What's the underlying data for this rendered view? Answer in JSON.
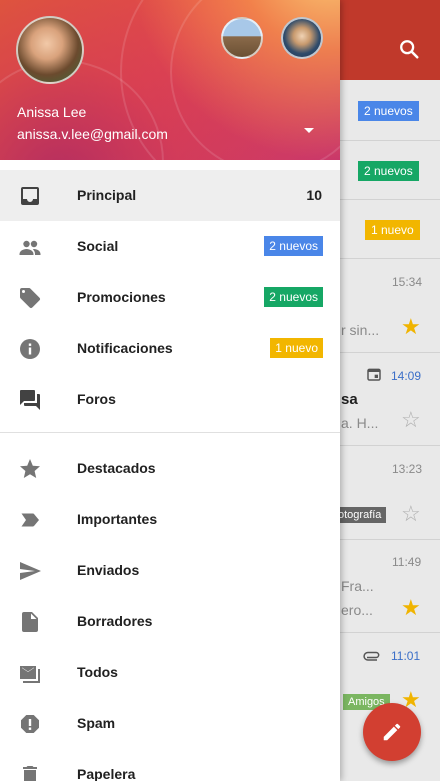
{
  "account": {
    "name": "Anissa Lee",
    "email": "anissa.v.lee@gmail.com"
  },
  "categories": [
    {
      "label": "Principal",
      "icon": "inbox-icon",
      "count": "10",
      "badge": ""
    },
    {
      "label": "Social",
      "icon": "people-icon",
      "count": "",
      "badge": "2 nuevos",
      "badge_color": "#4a86e8"
    },
    {
      "label": "Promociones",
      "icon": "tag-icon",
      "count": "",
      "badge": "2 nuevos",
      "badge_color": "#16a765"
    },
    {
      "label": "Notificaciones",
      "icon": "info-icon",
      "count": "",
      "badge": "1 nuevo",
      "badge_color": "#f2b600"
    },
    {
      "label": "Foros",
      "icon": "forum-icon",
      "count": "",
      "badge": ""
    }
  ],
  "folders": [
    {
      "label": "Destacados",
      "icon": "star-icon"
    },
    {
      "label": "Importantes",
      "icon": "important-icon"
    },
    {
      "label": "Enviados",
      "icon": "send-icon"
    },
    {
      "label": "Borradores",
      "icon": "draft-icon"
    },
    {
      "label": "Todos",
      "icon": "all-mail-icon"
    },
    {
      "label": "Spam",
      "icon": "spam-icon"
    },
    {
      "label": "Papelera",
      "icon": "trash-icon"
    }
  ],
  "background": {
    "chips": [
      {
        "text": "2 nuevos",
        "color": "#4a86e8"
      },
      {
        "text": "2 nuevos",
        "color": "#16a765"
      },
      {
        "text": "1 nuevo",
        "color": "#f2b600"
      }
    ],
    "times": [
      "15:34",
      "14:09",
      "13:23",
      "11:49",
      "11:01"
    ],
    "snippets": [
      "r sin...",
      "sa",
      "a. H...",
      "Fra...",
      "ero..."
    ],
    "labels": [
      {
        "text": "otografía",
        "color": "#666666"
      },
      {
        "text": "Amigos",
        "color": "#7bb661"
      }
    ]
  },
  "colors": {
    "appbar": "#c0392b",
    "fab": "#d23f31",
    "selected_row": "#eeeeee"
  }
}
